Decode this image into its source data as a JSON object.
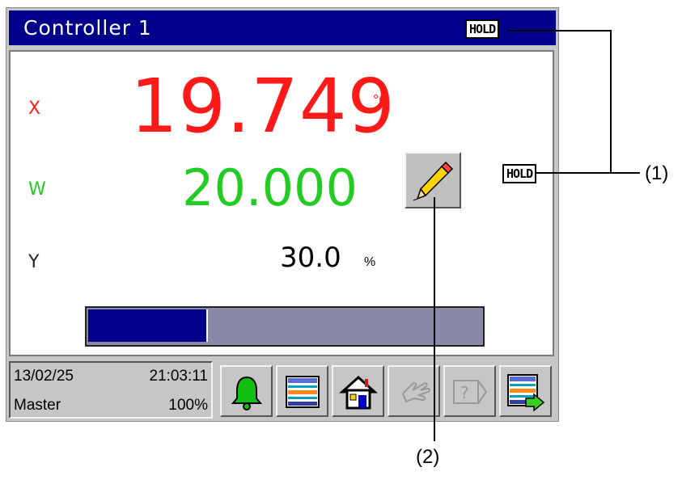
{
  "window": {
    "title": "Controller 1",
    "hold_badge": "HOLD"
  },
  "readings": {
    "x": {
      "label": "X",
      "value": "19.749",
      "unit": "°C"
    },
    "w": {
      "label": "W",
      "value": "20.000"
    },
    "y": {
      "label": "Y",
      "value": "30.0",
      "unit": "%"
    }
  },
  "side_hold_badge": "HOLD",
  "output_bar": {
    "level_fraction": 0.3
  },
  "status": {
    "date": "13/02/25",
    "time": "21:03:11",
    "user": "Master",
    "level": "100%"
  },
  "toolbar": {
    "buttons": [
      {
        "icon": "bell-icon",
        "enabled": true
      },
      {
        "icon": "list-icon",
        "enabled": true
      },
      {
        "icon": "home-icon",
        "enabled": true
      },
      {
        "icon": "hand-icon",
        "enabled": false
      },
      {
        "icon": "help-icon",
        "enabled": false
      },
      {
        "icon": "list-next-icon",
        "enabled": true
      }
    ]
  },
  "colors": {
    "title_bar": "#00008b",
    "x_value": "#ff1a1a",
    "w_value": "#22cc22",
    "bar_fill": "#00008b",
    "bar_track": "#8a8aa8",
    "alarm_bell": "#10c010"
  },
  "callouts": [
    {
      "label": "(1)"
    },
    {
      "label": "(2)"
    }
  ]
}
